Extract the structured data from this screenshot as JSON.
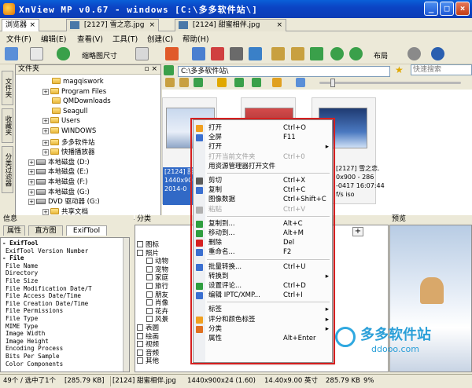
{
  "window": {
    "title": "XnView MP v0.67 - windows [C:\\多多软件站\\]",
    "controls": [
      "_",
      "□",
      "×"
    ]
  },
  "tabs": [
    {
      "label": "浏览器",
      "close": "×"
    },
    {
      "label": "[2127] 雪之恋.jpg",
      "close": "×"
    },
    {
      "label": "[2124] 甜蜜相伴.jpg",
      "close": "×"
    }
  ],
  "menubar": [
    "文件(F)",
    "编辑(E)",
    "查看(V)",
    "工具(T)",
    "创建(C)",
    "帮助(H)"
  ],
  "toolbar": {
    "thumb_size_label": "缩略图尺寸",
    "layout_label": "布局"
  },
  "side_tabs": [
    "文件夹",
    "收藏夹",
    "分类过滤器"
  ],
  "folder_panel": {
    "title": "文件夹",
    "pin_icons": "▫ ×",
    "items": [
      {
        "label": "magqiswork",
        "type": "folder",
        "expander": ""
      },
      {
        "label": "Program Files",
        "type": "folder",
        "expander": "+"
      },
      {
        "label": "QMDownloads",
        "type": "folder",
        "expander": ""
      },
      {
        "label": "Seagull",
        "type": "folder",
        "expander": ""
      },
      {
        "label": "Users",
        "type": "folder",
        "expander": "+"
      },
      {
        "label": "WINDOWS",
        "type": "folder",
        "expander": "+"
      },
      {
        "label": "多多软件站",
        "type": "folder",
        "expander": "+"
      },
      {
        "label": "快播播放器",
        "type": "folder",
        "expander": "+"
      },
      {
        "label": "本地磁盘 (D:)",
        "type": "drive",
        "expander": "+"
      },
      {
        "label": "本地磁盘 (E:)",
        "type": "drive",
        "expander": "+"
      },
      {
        "label": "本地磁盘 (F:)",
        "type": "drive",
        "expander": "+"
      },
      {
        "label": "本地磁盘 (G:)",
        "type": "drive",
        "expander": "+"
      },
      {
        "label": "DVD 驱动器 (G:)",
        "type": "drive",
        "expander": "+"
      },
      {
        "label": "共享文档",
        "type": "folder",
        "expander": "+"
      }
    ]
  },
  "path_bar": {
    "path": "C:\\多多软件站\\",
    "search_placeholder": "快速搜索"
  },
  "thumbnails": [
    {
      "name": "[2124]",
      "lines": [
        "[2124] 甜蜜",
        "1440x900",
        "2014-0"
      ]
    },
    {
      "name": "",
      "lines": []
    },
    {
      "name": "[2127] 雪之恋.jpg",
      "lines": [
        "[2127] 雪之恋.",
        "0x900 - 286",
        "-0417 16:07:44",
        "",
        "f/s iso"
      ]
    }
  ],
  "context_menu": {
    "items": [
      {
        "label": "打开",
        "shortcut": "Ctrl+O",
        "icon": "open-icon",
        "color": "#f0a020"
      },
      {
        "label": "全屏",
        "shortcut": "F11",
        "icon": "fullscreen-icon",
        "color": "#3a6fd0"
      },
      {
        "label": "打开",
        "shortcut": "",
        "arrow": "▸",
        "icon": "",
        "color": ""
      },
      {
        "label": "打开当前文件夹",
        "shortcut": "Ctrl+0",
        "disabled": true,
        "icon": "",
        "color": ""
      },
      {
        "label": "用资源管理器打开文件",
        "shortcut": "",
        "icon": "",
        "color": ""
      },
      {
        "sep": true
      },
      {
        "label": "剪切",
        "shortcut": "Ctrl+X",
        "icon": "cut-icon",
        "color": "#5a5a5a"
      },
      {
        "label": "复制",
        "shortcut": "Ctrl+C",
        "icon": "copy-icon",
        "color": "#3a6fd0"
      },
      {
        "label": "图像数据",
        "shortcut": "Ctrl+Shift+C",
        "icon": "",
        "color": ""
      },
      {
        "label": "粘贴",
        "shortcut": "Ctrl+V",
        "disabled": true,
        "icon": "paste-icon",
        "color": "#b0b0b0"
      },
      {
        "sep": true
      },
      {
        "label": "复制到...",
        "shortcut": "Alt+C",
        "icon": "copy-to-icon",
        "color": "#2f9e3f"
      },
      {
        "label": "移动到...",
        "shortcut": "Alt+M",
        "icon": "move-to-icon",
        "color": "#2f9e3f"
      },
      {
        "label": "删除",
        "shortcut": "Del",
        "icon": "delete-icon",
        "color": "#d62020"
      },
      {
        "label": "重命名...",
        "shortcut": "F2",
        "icon": "rename-icon",
        "color": "#3a6fd0"
      },
      {
        "sep": true
      },
      {
        "label": "批量转换...",
        "shortcut": "Ctrl+U",
        "icon": "batch-icon",
        "color": "#3a6fd0"
      },
      {
        "label": "转换到",
        "shortcut": "",
        "arrow": "▸",
        "icon": "",
        "color": ""
      },
      {
        "label": "设置评论...",
        "shortcut": "Ctrl+D",
        "icon": "comment-icon",
        "color": "#2f9e3f"
      },
      {
        "label": "编辑 IPTC/XMP...",
        "shortcut": "Ctrl+I",
        "icon": "iptc-icon",
        "color": "#3a6fd0"
      },
      {
        "sep": true
      },
      {
        "label": "标签",
        "shortcut": "",
        "arrow": "▸",
        "icon": "",
        "color": ""
      },
      {
        "label": "评分和颜色标签",
        "shortcut": "",
        "arrow": "▸",
        "icon": "rating-icon",
        "color": "#f0a020"
      },
      {
        "label": "分类",
        "shortcut": "",
        "arrow": "▸",
        "icon": "category-icon",
        "color": "#e07020"
      },
      {
        "label": "属性",
        "shortcut": "Alt+Enter",
        "icon": "",
        "color": ""
      }
    ]
  },
  "info_panel": {
    "title": "信息",
    "tabs": [
      "属性",
      "直方图",
      "ExifTool"
    ],
    "rows": [
      "- ExifTool",
      "  ExifTool Version Number",
      "- File",
      "  File Name",
      "  Directory",
      "  File Size",
      "  File Modification Date/T",
      "  File Access Date/Time",
      "  File Creation Date/Time",
      "  File Permissions",
      "  File Type",
      "  MIME Type",
      "  Image Width",
      "  Image Height",
      "  Encoding Process",
      "  Bits Per Sample",
      "  Color Components"
    ]
  },
  "categories_panel": {
    "title": "分类",
    "items": [
      {
        "label": "图标",
        "level": 0
      },
      {
        "label": "照片",
        "level": 0
      },
      {
        "label": "动物",
        "level": 1
      },
      {
        "label": "宠物",
        "level": 1
      },
      {
        "label": "家庭",
        "level": 1
      },
      {
        "label": "旅行",
        "level": 1
      },
      {
        "label": "朋友",
        "level": 1
      },
      {
        "label": "肖像",
        "level": 1
      },
      {
        "label": "花卉",
        "level": 1
      },
      {
        "label": "风景",
        "level": 1
      },
      {
        "label": "表圆",
        "level": 0
      },
      {
        "label": "绘画",
        "level": 0
      },
      {
        "label": "视频",
        "level": 0
      },
      {
        "label": "音频",
        "level": 0
      },
      {
        "label": "其他",
        "level": 0
      }
    ]
  },
  "preview_panel": {
    "title": "预览"
  },
  "watermark": {
    "name": "多多软件站",
    "url": "ddooo.com"
  },
  "statusbar": {
    "count": "49个 / 选中了1个",
    "size": "[285.79 KB]",
    "file": "[2124] 甜蜜相伴.jpg",
    "dims": "1440x900x24 (1.60)",
    "inch": "14.40x9.00 英寸",
    "fsize": "285.79 KB",
    "zoom": "9%"
  }
}
